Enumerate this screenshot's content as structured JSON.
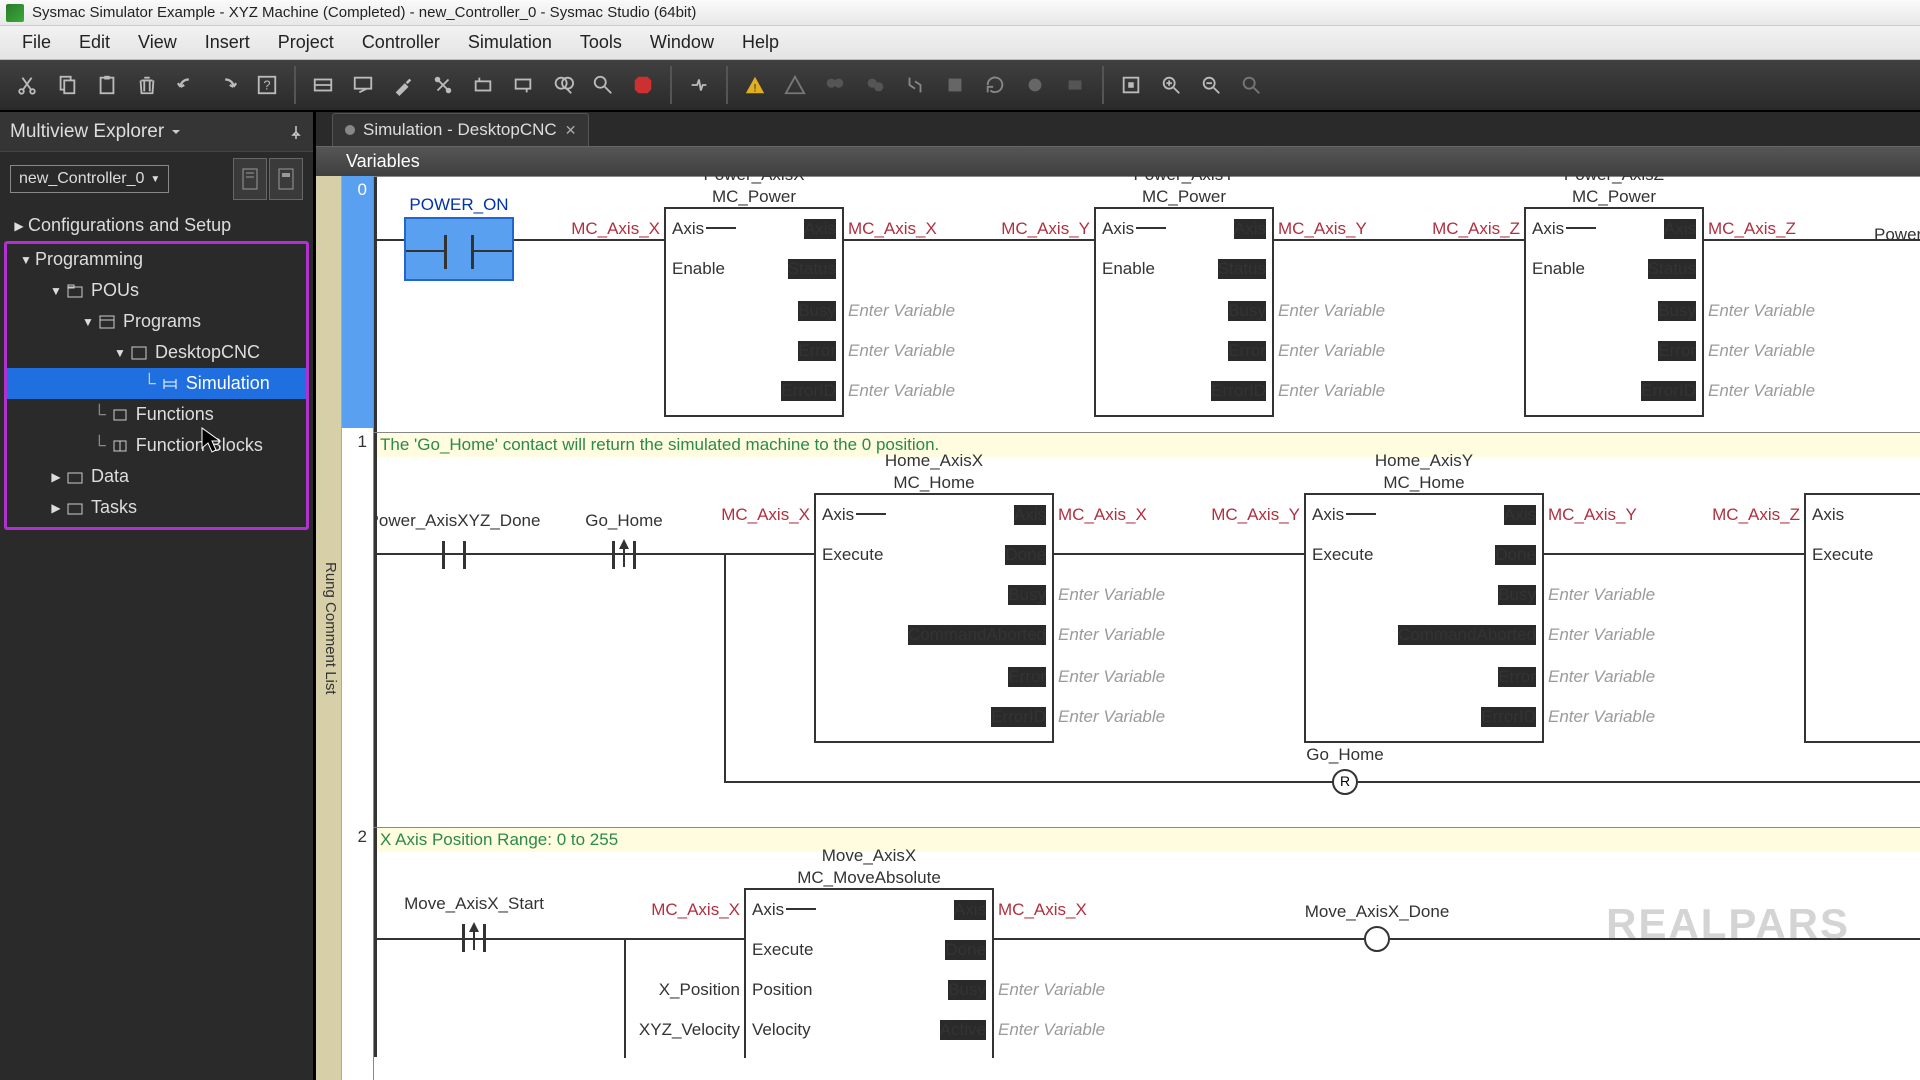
{
  "title": "Sysmac Simulator Example - XYZ Machine (Completed) - new_Controller_0 - Sysmac Studio (64bit)",
  "menu": [
    "File",
    "Edit",
    "View",
    "Insert",
    "Project",
    "Controller",
    "Simulation",
    "Tools",
    "Window",
    "Help"
  ],
  "explorer": {
    "title": "Multiview Explorer",
    "controller": "new_Controller_0",
    "tree": {
      "config": "Configurations and Setup",
      "programming": "Programming",
      "pous": "POUs",
      "programs": "Programs",
      "desktopcnc": "DesktopCNC",
      "simulation": "Simulation",
      "functions": "Functions",
      "functionblocks": "Function Blocks",
      "data": "Data",
      "tasks": "Tasks"
    }
  },
  "tab": {
    "label": "Simulation - DesktopCNC"
  },
  "vars_label": "Variables",
  "rung_strip": "Rung Comment List",
  "rungs": {
    "r0": {
      "num": "0"
    },
    "r1": {
      "num": "1",
      "comment": "The 'Go_Home' contact will return the simulated machine to the 0 position."
    },
    "r2": {
      "num": "2",
      "comment": "X Axis Position Range: 0 to 255"
    }
  },
  "contacts": {
    "power_on": "POWER_ON",
    "pxyz_done": "Power_AxisXYZ_Done",
    "go_home": "Go_Home",
    "mvx_start": "Move_AxisX_Start"
  },
  "coils": {
    "go_home": "Go_Home",
    "mvx_done": "Move_AxisX_Done"
  },
  "fb": {
    "mc_power": "MC_Power",
    "mc_home": "MC_Home",
    "mc_moveabs": "MC_MoveAbsolute",
    "power_x": "Power_AxisX",
    "power_y": "Power_AxisY",
    "power_z": "Power_AxisZ",
    "home_x": "Home_AxisX",
    "home_y": "Home_AxisY",
    "move_x": "Move_AxisX",
    "axis": "Axis",
    "enable": "Enable",
    "status": "Status",
    "busy": "Busy",
    "error": "Error",
    "errorid": "ErrorID",
    "execute": "Execute",
    "done": "Done",
    "cmdabort": "CommandAborted",
    "position": "Position",
    "velocity": "Velocity",
    "active": "Active",
    "enter_var": "Enter Variable"
  },
  "vars": {
    "mc_x": "MC_Axis_X",
    "mc_y": "MC_Axis_Y",
    "mc_z": "MC_Axis_Z",
    "x_pos": "X_Position",
    "xyz_vel": "XYZ_Velocity",
    "power": "Power"
  },
  "watermark": "REALPARS"
}
